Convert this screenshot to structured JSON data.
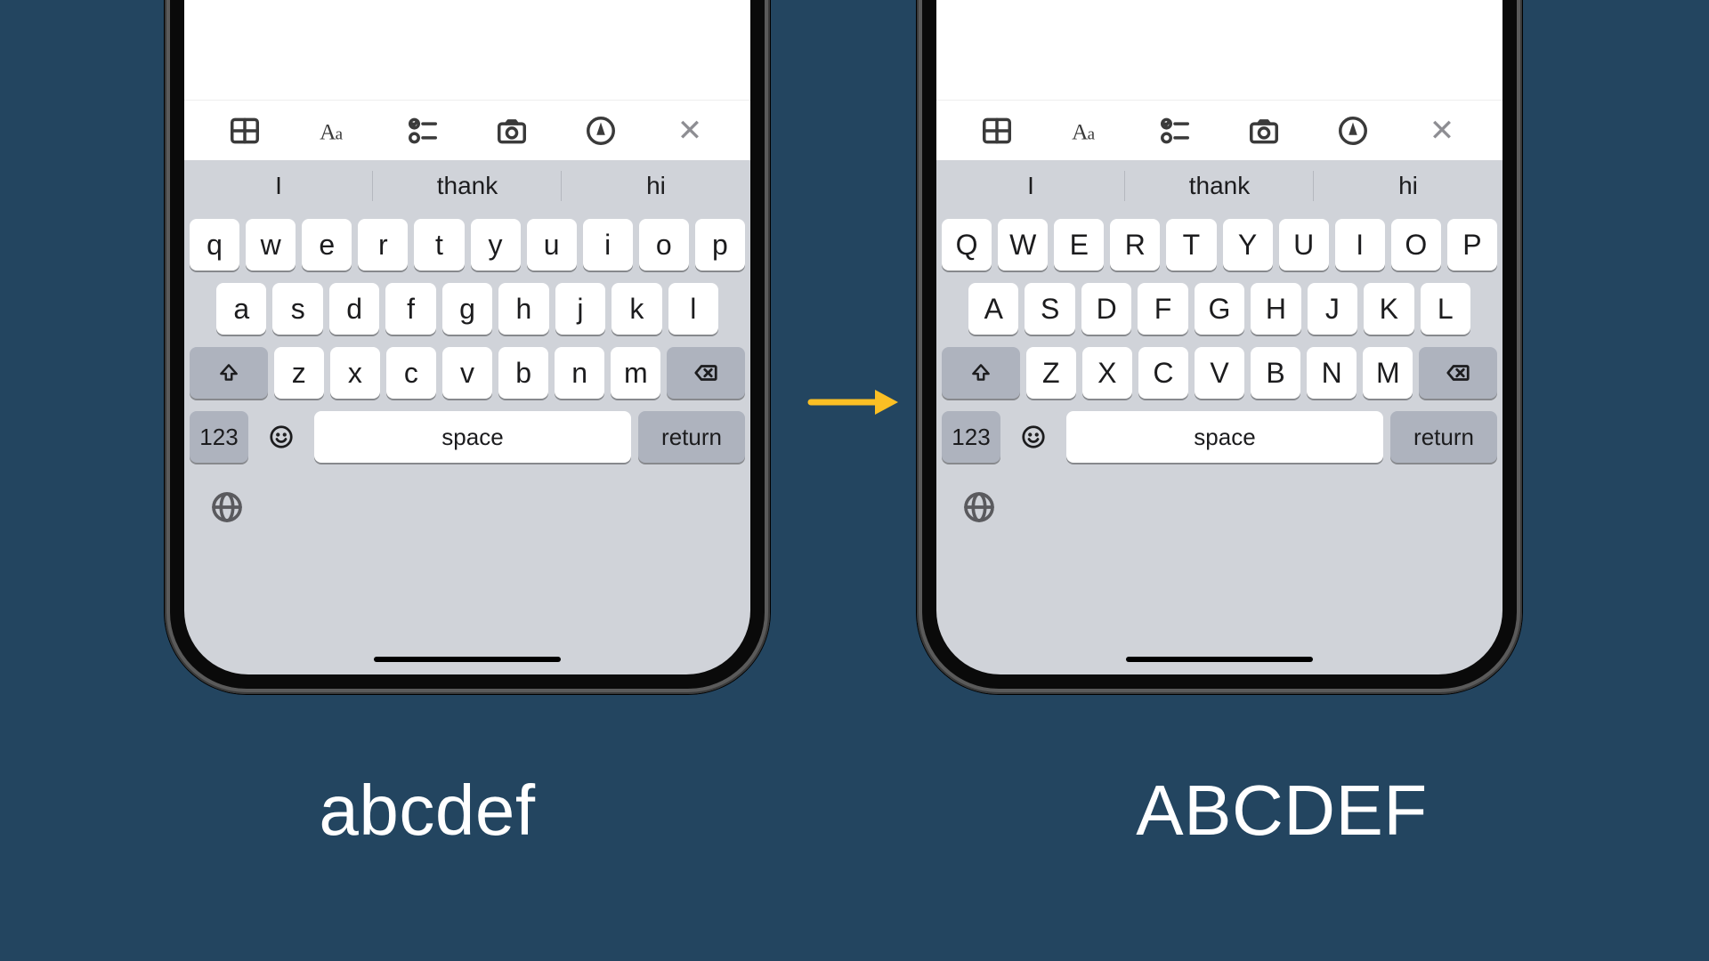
{
  "captions": {
    "left": "abcdef",
    "right": "ABCDEF"
  },
  "toolbar_icons": [
    "table-icon",
    "text-format-icon",
    "checklist-icon",
    "camera-icon",
    "markup-icon",
    "close-icon"
  ],
  "predictive": [
    "I",
    "thank",
    "hi"
  ],
  "keyboard_function": {
    "numbers_label": "123",
    "space_label": "space",
    "return_label": "return"
  },
  "keyboards": {
    "left": {
      "row1": [
        "q",
        "w",
        "e",
        "r",
        "t",
        "y",
        "u",
        "i",
        "o",
        "p"
      ],
      "row2": [
        "a",
        "s",
        "d",
        "f",
        "g",
        "h",
        "j",
        "k",
        "l"
      ],
      "row3": [
        "z",
        "x",
        "c",
        "v",
        "b",
        "n",
        "m"
      ]
    },
    "right": {
      "row1": [
        "Q",
        "W",
        "E",
        "R",
        "T",
        "Y",
        "U",
        "I",
        "O",
        "P"
      ],
      "row2": [
        "A",
        "S",
        "D",
        "F",
        "G",
        "H",
        "J",
        "K",
        "L"
      ],
      "row3": [
        "Z",
        "X",
        "C",
        "V",
        "B",
        "N",
        "M"
      ]
    }
  }
}
